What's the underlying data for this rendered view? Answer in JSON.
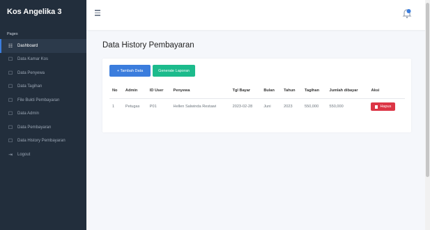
{
  "sidebar": {
    "brand": "Kos Angelika 3",
    "section": "Pages",
    "items": [
      {
        "label": "Dashboard",
        "icon": "sliders-icon"
      },
      {
        "label": "Data Kamar Kos",
        "icon": "square-icon"
      },
      {
        "label": "Data Penyewa",
        "icon": "square-icon"
      },
      {
        "label": "Data Tagihan",
        "icon": "square-icon"
      },
      {
        "label": "File Bukti Pembayaran",
        "icon": "square-icon"
      },
      {
        "label": "Data Admin",
        "icon": "square-icon"
      },
      {
        "label": "Data Pembayaran",
        "icon": "square-icon"
      },
      {
        "label": "Data History Pembayaran",
        "icon": "square-icon"
      },
      {
        "label": "Logout",
        "icon": "logout-icon"
      }
    ]
  },
  "main": {
    "title": "Data History Pembayaran",
    "add_button": "+ Tambah Data",
    "generate_button": "Generate Laporan",
    "table": {
      "headers": [
        "No",
        "Admin",
        "ID User",
        "Penyewa",
        "Tgl Bayar",
        "Bulan",
        "Tahun",
        "Tagihan",
        "Jumlah dibayar",
        "Aksi"
      ],
      "rows": [
        {
          "no": "1",
          "admin": "Petugas",
          "id_user": "P01",
          "penyewa": "Hellen Salwinda Restawi",
          "tgl_bayar": "2023-02-28",
          "bulan": "Juni",
          "tahun": "2023",
          "tagihan": "550,000",
          "jumlah": "550,000",
          "aksi": "Hapus"
        }
      ]
    }
  },
  "colors": {
    "sidebar": "#222e3c",
    "primary": "#3b7ddd",
    "success": "#1cbb8c",
    "danger": "#dc3545"
  }
}
